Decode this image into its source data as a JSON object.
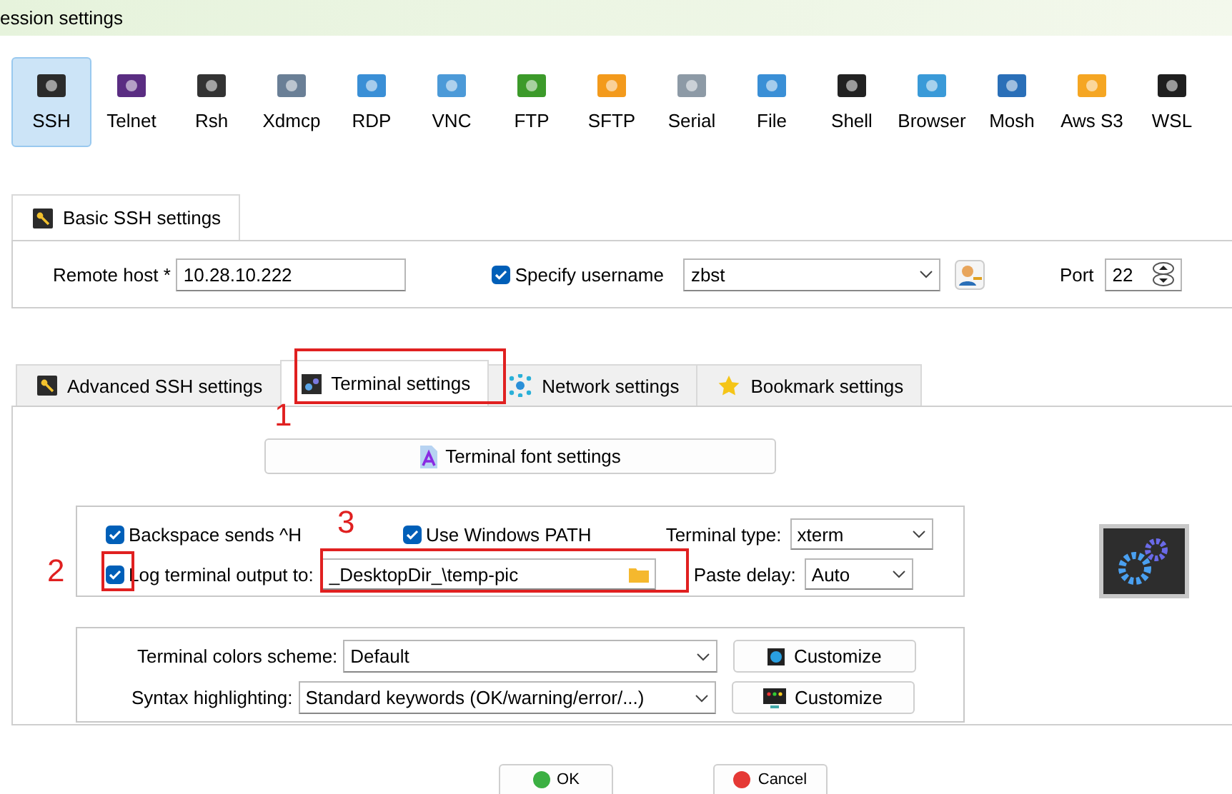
{
  "window": {
    "title": "ession settings"
  },
  "protocols": [
    {
      "label": "SSH",
      "selected": true
    },
    {
      "label": "Telnet",
      "selected": false
    },
    {
      "label": "Rsh",
      "selected": false
    },
    {
      "label": "Xdmcp",
      "selected": false
    },
    {
      "label": "RDP",
      "selected": false
    },
    {
      "label": "VNC",
      "selected": false
    },
    {
      "label": "FTP",
      "selected": false
    },
    {
      "label": "SFTP",
      "selected": false
    },
    {
      "label": "Serial",
      "selected": false
    },
    {
      "label": "File",
      "selected": false
    },
    {
      "label": "Shell",
      "selected": false
    },
    {
      "label": "Browser",
      "selected": false
    },
    {
      "label": "Mosh",
      "selected": false
    },
    {
      "label": "Aws S3",
      "selected": false
    },
    {
      "label": "WSL",
      "selected": false
    }
  ],
  "basic": {
    "tab": "Basic SSH settings",
    "remote_host_label": "Remote host *",
    "remote_host": "10.28.10.222",
    "specify_username": {
      "label": "Specify username",
      "checked": true
    },
    "username": "zbst",
    "port_label": "Port",
    "port": "22"
  },
  "tabs": [
    {
      "label": "Advanced SSH settings",
      "selected": false
    },
    {
      "label": "Terminal settings",
      "selected": true
    },
    {
      "label": "Network settings",
      "selected": false
    },
    {
      "label": "Bookmark settings",
      "selected": false
    }
  ],
  "terminal": {
    "font_button": "Terminal font settings",
    "backspace": {
      "label": "Backspace sends ^H",
      "checked": true
    },
    "windows_path": {
      "label": "Use Windows PATH",
      "checked": true
    },
    "terminal_type_label": "Terminal type:",
    "terminal_type": "xterm",
    "log_output": {
      "label": "Log terminal output to:",
      "checked": true
    },
    "log_path": "_DesktopDir_\\temp-pic",
    "paste_delay_label": "Paste delay:",
    "paste_delay": "Auto",
    "colors_label": "Terminal colors scheme:",
    "colors": "Default",
    "colors_button": "Customize",
    "syntax_label": "Syntax highlighting:",
    "syntax": "Standard keywords (OK/warning/error/...)",
    "syntax_button": "Customize"
  },
  "annotations": [
    "1",
    "2",
    "3"
  ],
  "buttons": [
    "OK",
    "Cancel"
  ]
}
